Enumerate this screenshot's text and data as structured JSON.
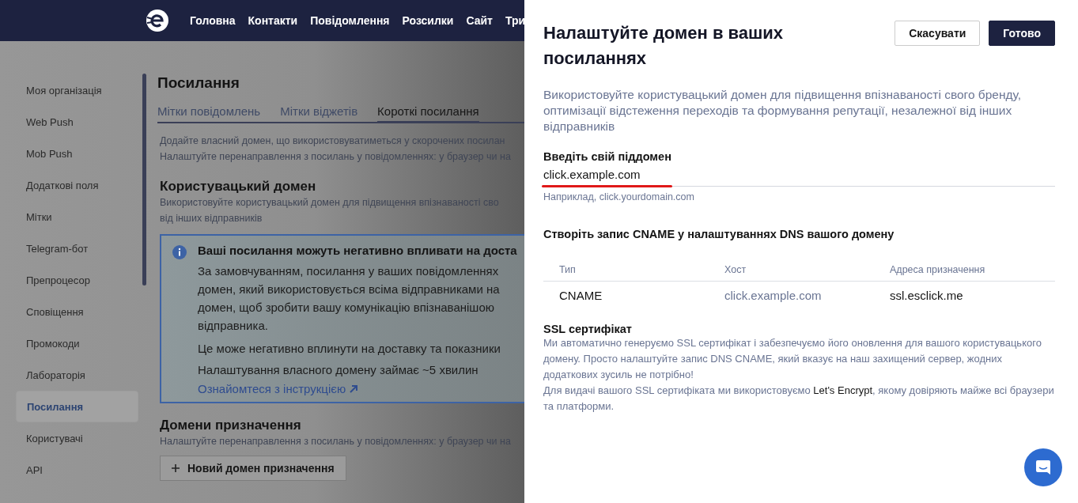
{
  "nav": {
    "items": [
      "Головна",
      "Контакти",
      "Повідомлення",
      "Розсилки",
      "Сайт",
      "Три"
    ]
  },
  "sidebar": {
    "items": [
      {
        "label": "Моя організація",
        "selected": false
      },
      {
        "label": "Web Push",
        "selected": false
      },
      {
        "label": "Mob Push",
        "selected": false
      },
      {
        "label": "Додаткові поля",
        "selected": false
      },
      {
        "label": "Мітки",
        "selected": false
      },
      {
        "label": "Telegram-бот",
        "selected": false
      },
      {
        "label": "Препроцесор",
        "selected": false
      },
      {
        "label": "Сповіщення",
        "selected": false
      },
      {
        "label": "Промокоди",
        "selected": false
      },
      {
        "label": "Лабораторія",
        "selected": false
      },
      {
        "label": "Посилання",
        "selected": true
      },
      {
        "label": "Користувачі",
        "selected": false
      },
      {
        "label": "API",
        "selected": false
      }
    ]
  },
  "page": {
    "title": "Посилання",
    "tabs": [
      {
        "label": "Мітки повідомлень",
        "selected": false
      },
      {
        "label": "Мітки віджетів",
        "selected": false
      },
      {
        "label": "Короткі посилання",
        "selected": true
      }
    ],
    "intro": [
      "Додайте власний домен, що використовуватиметься у скорочених посилан",
      "Налаштуйте перенаправлення з посилань у повідомленнях: у браузер чи на"
    ],
    "custom_domain": {
      "heading": "Користувацький домен",
      "description": [
        "Використовуйте користувацький домен для підвищення впізнаваності сво",
        "від інших відправників"
      ]
    },
    "alert": {
      "title": "Ваші посилання можуть негативно впливати на доста",
      "lines": [
        "За замовчуванням, посилання у ваших повідомленнях",
        "домен, який використовується всіма відправниками на",
        "домен, щоб зробити вашу комунікацію впізнаванішою",
        "відправника."
      ],
      "notes": [
        "Це може негативно вплинути на доставку та показники",
        "Налаштування власного домену займає ~5 хвилин"
      ],
      "link": "Ознайомтеся з інструкцією"
    },
    "destinations": {
      "heading": "Домени призначення",
      "description": "Налаштуйте перенаправлення з посилань у повідомленнях: у браузер чи на",
      "button": "Новий домен призначення"
    }
  },
  "drawer": {
    "title": "Налаштуйте домен в ваших посиланнях",
    "buttons": {
      "cancel": "Скасувати",
      "done": "Готово"
    },
    "description": "Використовуйте користувацький домен для підвищення впізнаваності свого бренду, оптимізації відстеження переходів та формування репутації, незалежної від інших відправників",
    "subdomain": {
      "label": "Введіть свій піддомен",
      "value": "click.example.com",
      "hint": "Наприклад, click.yourdomain.com"
    },
    "cname": {
      "heading": "Створіть запис CNAME у налаштуваннях DNS вашого домену",
      "columns": [
        "Тип",
        "Хост",
        "Адреса призначення"
      ],
      "rows": [
        [
          "CNAME",
          "click.example.com",
          "ssl.esclick.me"
        ]
      ]
    },
    "ssl": {
      "heading": "SSL сертифікат",
      "paragraphs": [
        "Ми автоматично генеруємо SSL сертифікат і забезпечуємо його оновлення для вашого користувацького домену. Просто налаштуйте запис DNS CNAME, який вказує на наш захищений сервер, жодних додаткових зусиль не потрібно!",
        "Для видачі вашого SSL сертифіката ми використовуємо **Let's Encrypt**, якому довіряють майже всі браузери та платформи."
      ]
    }
  }
}
